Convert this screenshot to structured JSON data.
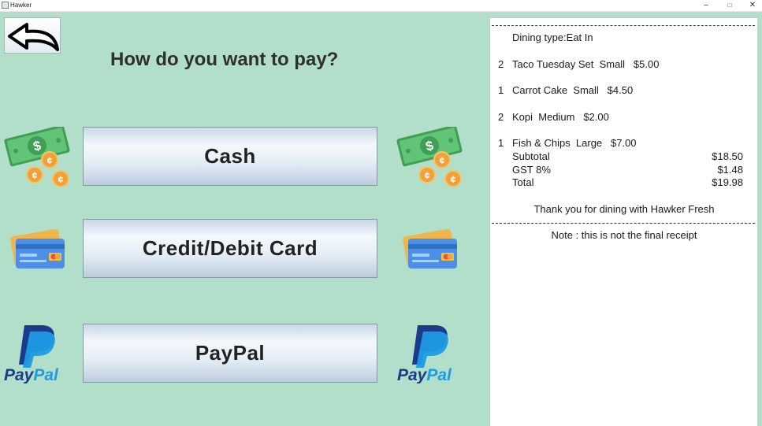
{
  "window": {
    "title": "Hawker",
    "minimize": "–",
    "maximize": "□",
    "close": "✕"
  },
  "page": {
    "heading": "How do you want to pay?"
  },
  "payment_options": [
    {
      "label": "Cash",
      "icon": "cash-icon"
    },
    {
      "label": "Credit/Debit Card",
      "icon": "credit-card-icon"
    },
    {
      "label": "PayPal",
      "icon": "paypal-logo"
    }
  ],
  "paypal_logo_text": {
    "pay": "Pay",
    "pal": "Pal"
  },
  "receipt": {
    "dining_type": "Dining type:Eat In",
    "items": [
      {
        "qty": "2",
        "desc": "Taco Tuesday Set  Small   $5.00"
      },
      {
        "qty": "1",
        "desc": "Carrot Cake  Small   $4.50"
      },
      {
        "qty": "2",
        "desc": "Kopi  Medium   $2.00"
      },
      {
        "qty": "1",
        "desc": "Fish & Chips  Large   $7.00"
      }
    ],
    "totals": [
      {
        "label": "Subtotal",
        "value": "$18.50"
      },
      {
        "label": "GST 8%",
        "value": "$1.48"
      },
      {
        "label": "Total",
        "value": "$19.98"
      }
    ],
    "thank_you": "Thank you for dining with Hawker Fresh",
    "note": "Note : this is not the final receipt"
  },
  "colors": {
    "background": "#b2dfca",
    "receipt_bg": "#ffffff",
    "paypal_dark": "#1b3b8b",
    "paypal_light": "#1e9be4",
    "cash_green": "#56b96b"
  }
}
